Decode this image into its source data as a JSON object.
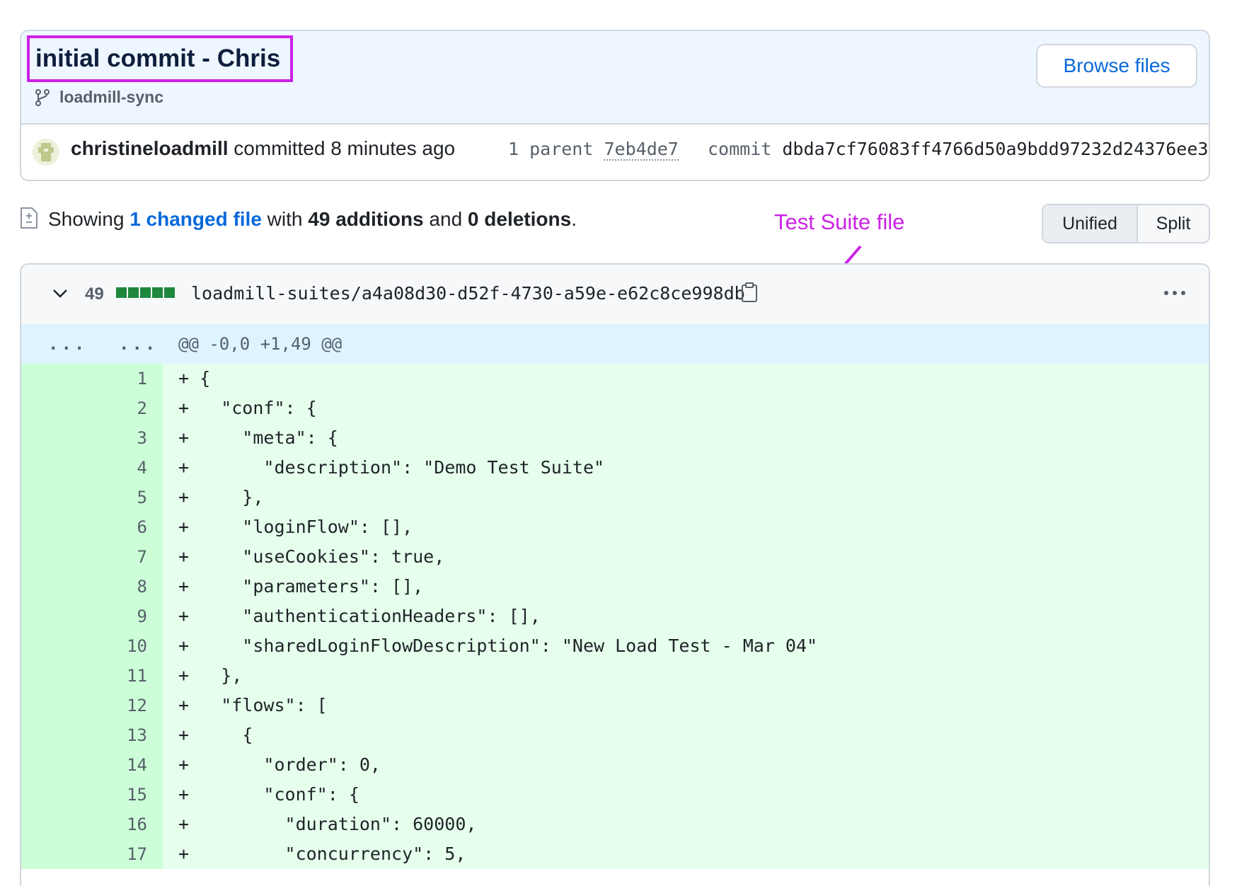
{
  "commit": {
    "title": "initial commit - Chris",
    "branch": "loadmill-sync",
    "browse_files": "Browse files",
    "author": "christineloadmill",
    "committed_text": " committed 8 minutes ago",
    "parent_label": "1 parent",
    "parent_sha": "7eb4de7",
    "commit_label": "commit",
    "commit_sha": "dbda7cf76083ff4766d50a9bdd97232d24376ee3"
  },
  "summary": {
    "showing": "Showing ",
    "changed_link": "1 changed file",
    "with": " with ",
    "additions": "49 additions",
    "and": " and ",
    "deletions": "0 deletions",
    "end": "."
  },
  "view_toggle": {
    "unified": "Unified",
    "split": "Split",
    "selected": "Unified"
  },
  "annotation": {
    "label": "Test Suite file",
    "color": "#cc22e6"
  },
  "file": {
    "additions_count": "49",
    "path": "loadmill-suites/a4a08d30-d52f-4730-a59e-e62c8ce998db",
    "hunk_dots_left": "...",
    "hunk_dots_right": "...",
    "hunk_header": "@@ -0,0 +1,49 @@",
    "lines": [
      {
        "num": "1",
        "text": "+ {"
      },
      {
        "num": "2",
        "text": "+   \"conf\": {"
      },
      {
        "num": "3",
        "text": "+     \"meta\": {"
      },
      {
        "num": "4",
        "text": "+       \"description\": \"Demo Test Suite\""
      },
      {
        "num": "5",
        "text": "+     },"
      },
      {
        "num": "6",
        "text": "+     \"loginFlow\": [],"
      },
      {
        "num": "7",
        "text": "+     \"useCookies\": true,"
      },
      {
        "num": "8",
        "text": "+     \"parameters\": [],"
      },
      {
        "num": "9",
        "text": "+     \"authenticationHeaders\": [],"
      },
      {
        "num": "10",
        "text": "+     \"sharedLoginFlowDescription\": \"New Load Test - Mar 04\""
      },
      {
        "num": "11",
        "text": "+   },"
      },
      {
        "num": "12",
        "text": "+   \"flows\": ["
      },
      {
        "num": "13",
        "text": "+     {"
      },
      {
        "num": "14",
        "text": "+       \"order\": 0,"
      },
      {
        "num": "15",
        "text": "+       \"conf\": {"
      },
      {
        "num": "16",
        "text": "+         \"duration\": 60000,"
      },
      {
        "num": "17",
        "text": "+         \"concurrency\": 5,"
      }
    ]
  },
  "colors": {
    "accent_link": "#0969da",
    "addition_bg": "#e6ffec",
    "addition_gutter": "#ccffd8",
    "hunk_bg": "#ddf4ff",
    "diffstat_green": "#1f883d"
  }
}
